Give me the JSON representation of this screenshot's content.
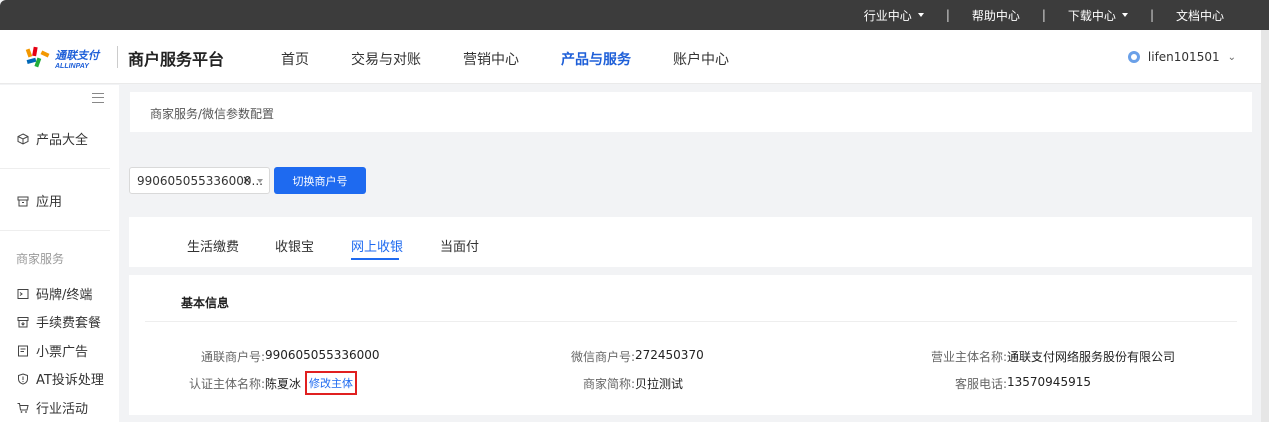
{
  "topbar": {
    "links": [
      {
        "label": "行业中心",
        "dropdown": true
      },
      {
        "label": "帮助中心",
        "dropdown": false
      },
      {
        "label": "下载中心",
        "dropdown": true
      },
      {
        "label": "文档中心",
        "dropdown": false
      }
    ]
  },
  "header": {
    "logo_text": "通联支付",
    "logo_subtext": "ALLINPAY",
    "platform_title": "商户服务平台",
    "nav": [
      {
        "label": "首页",
        "active": false
      },
      {
        "label": "交易与对账",
        "active": false
      },
      {
        "label": "营销中心",
        "active": false
      },
      {
        "label": "产品与服务",
        "active": true
      },
      {
        "label": "账户中心",
        "active": false
      }
    ],
    "username": "lifen101501"
  },
  "sidebar": {
    "top_items": [
      {
        "label": "产品大全",
        "icon": "cube-icon"
      },
      {
        "label": "应用",
        "icon": "archive-icon"
      }
    ],
    "section_title": "商家服务",
    "section_items": [
      {
        "label": "码牌/终端",
        "icon": "terminal-icon"
      },
      {
        "label": "手续费套餐",
        "icon": "package-icon"
      },
      {
        "label": "小票广告",
        "icon": "receipt-icon"
      },
      {
        "label": "AT投诉处理",
        "icon": "shield-icon"
      },
      {
        "label": "行业活动",
        "icon": "cart-icon"
      }
    ]
  },
  "breadcrumb": "商家服务/微信参数配置",
  "merchant_select": {
    "value": "990605055336000...",
    "clear": "×"
  },
  "switch_button": "切换商户号",
  "tabs": [
    {
      "label": "生活缴费",
      "active": false
    },
    {
      "label": "收银宝",
      "active": false
    },
    {
      "label": "网上收银",
      "active": true
    },
    {
      "label": "当面付",
      "active": false
    }
  ],
  "info": {
    "title": "基本信息",
    "fields": {
      "allinpay_merchant_no": {
        "label": "通联商户号:",
        "value": "990605055336000"
      },
      "certified_subject": {
        "label": "认证主体名称:",
        "value": "陈夏冰"
      },
      "modify_link": "修改主体",
      "wechat_merchant_no": {
        "label": "微信商户号:",
        "value": "272450370"
      },
      "merchant_short_name": {
        "label": "商家简称:",
        "value": "贝拉测试"
      },
      "business_subject": {
        "label": "营业主体名称:",
        "value": "通联支付网络服务股份有限公司"
      },
      "service_phone": {
        "label": "客服电话:",
        "value": "13570945915"
      }
    }
  },
  "colors": {
    "accent": "#1e6af0",
    "topbar": "#3c3c3c",
    "highlight_border": "#e02020"
  }
}
